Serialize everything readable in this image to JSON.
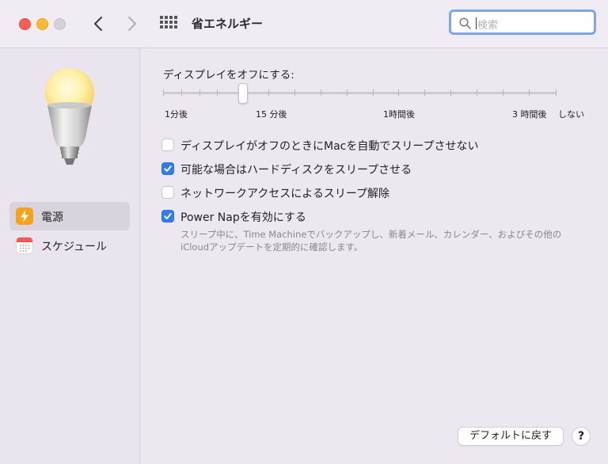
{
  "window": {
    "title": "省エネルギー",
    "traffic_lights": [
      "close",
      "minimize",
      "zoom"
    ]
  },
  "toolbar": {
    "back_icon": "chevron-left-icon",
    "forward_icon": "chevron-right-icon",
    "grid_icon": "grid-icon",
    "search_placeholder": "検索"
  },
  "sidebar": {
    "items": [
      {
        "label": "電源",
        "icon": "lightning-icon",
        "selected": true
      },
      {
        "label": "スケジュール",
        "icon": "calendar-icon",
        "selected": false
      }
    ]
  },
  "display_sleep": {
    "label": "ディスプレイをオフにする:",
    "value": "15 分後",
    "tick_labels": [
      "1分後",
      "15 分後",
      "1時間後",
      "3 時間後",
      "しない"
    ]
  },
  "options": [
    {
      "label": "ディスプレイがオフのときにMacを自動でスリープさせない",
      "checked": false
    },
    {
      "label": "可能な場合はハードディスクをスリープさせる",
      "checked": true
    },
    {
      "label": "ネットワークアクセスによるスリープ解除",
      "checked": false
    },
    {
      "label": "Power Napを有効にする",
      "checked": true
    }
  ],
  "power_nap_description_line1": "スリープ中に、Time Machineでバックアップし、新着メール、カレンダー、およびその他の",
  "power_nap_description_line2": "iCloudアップデートを定期的に確認します。",
  "buttons": {
    "defaults": "デフォルトに戻す",
    "help": "?"
  },
  "colors": {
    "accent": "#2d7cf6",
    "sidebar_selected": "#d8d3dc",
    "search_focus": "#7ba6e8"
  }
}
